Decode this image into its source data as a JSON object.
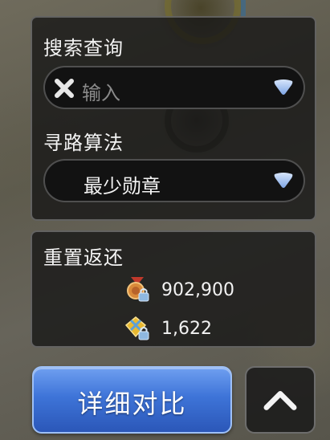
{
  "search": {
    "title": "搜索查询",
    "placeholder": "输入",
    "clear_icon": "close-x-icon",
    "dropdown_icon": "triangle-down-icon"
  },
  "algorithm": {
    "title": "寻路算法",
    "selected": "最少勋章",
    "dropdown_icon": "triangle-down-icon"
  },
  "reset_return": {
    "title": "重置返还",
    "items": [
      {
        "icon": "locked-medal-icon",
        "value": "902,900"
      },
      {
        "icon": "locked-gem-icon",
        "value": "1,622"
      }
    ]
  },
  "actions": {
    "compare_label": "详细对比",
    "collapse_icon": "chevron-up-icon"
  },
  "colors": {
    "accent_blue": "#3e74d8",
    "arrow_blue": "#9fc0f0",
    "panel_bg": "#141414"
  }
}
